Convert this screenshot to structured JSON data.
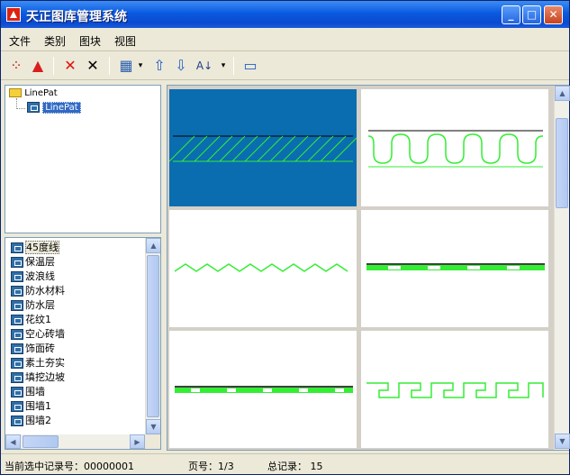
{
  "window": {
    "title": "天正图库管理系统",
    "minimize": "_",
    "maximize": "□",
    "close": "✕"
  },
  "menu": [
    "文件",
    "类别",
    "图块",
    "视图"
  ],
  "toolbar": {
    "accent": "#d81e1e",
    "tools": [
      {
        "name": "select-all-icon",
        "glyph": "⁘"
      },
      {
        "name": "warning-icon",
        "glyph": "▲"
      },
      {
        "name": "delete-red-icon",
        "glyph": "✕"
      },
      {
        "name": "delete-black-icon",
        "glyph": "✕"
      },
      {
        "name": "grid-view-icon",
        "glyph": "▦"
      },
      {
        "name": "dropdown-arrow-icon",
        "glyph": "▾"
      },
      {
        "name": "move-up-icon",
        "glyph": "⇧"
      },
      {
        "name": "move-down-icon",
        "glyph": "⇩"
      },
      {
        "name": "sort-icon",
        "glyph": "A↓"
      },
      {
        "name": "sort-dropdown-icon",
        "glyph": "▾"
      },
      {
        "name": "window-icon",
        "glyph": "▭"
      }
    ]
  },
  "tree": {
    "root": "LinePat",
    "child": "LinePat"
  },
  "list": {
    "items": [
      "45度线",
      "保温层",
      "波浪线",
      "防水材料",
      "防水层",
      "花纹1",
      "空心砖墙",
      "饰面砖",
      "素土夯实",
      "填挖边坡",
      "围墙",
      "围墙1",
      "围墙2"
    ]
  },
  "preview": {
    "selected_color": "#0a6db0",
    "pattern_color": "#33ee33",
    "thumbs": [
      "hatch-45",
      "bellows",
      "wave",
      "dash-line-1",
      "dash-line-2",
      "meander"
    ]
  },
  "status": {
    "current": "当前选中记录号：00000001",
    "page": "页号：1/3",
    "total": "总记录： 15"
  }
}
